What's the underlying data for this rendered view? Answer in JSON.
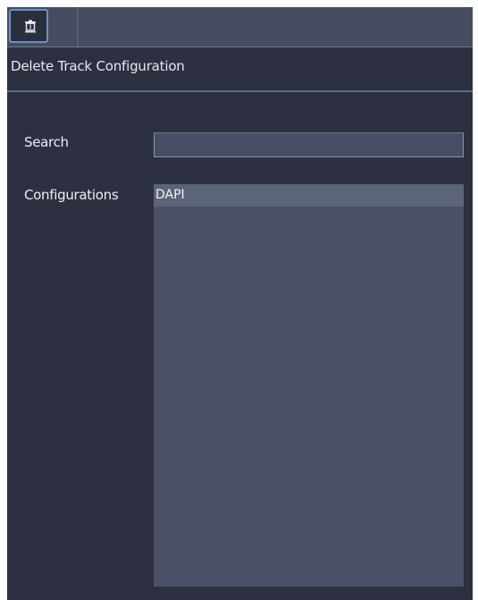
{
  "toolbar": {
    "icon": "delete-icon"
  },
  "dialog": {
    "title": "Delete Track Configuration"
  },
  "search": {
    "label": "Search",
    "value": "",
    "placeholder": ""
  },
  "configurations": {
    "label": "Configurations",
    "items": [
      {
        "label": "DAPI",
        "selected": true
      }
    ]
  },
  "colors": {
    "panel_bg": "#2c3040",
    "topbar_bg": "#464d61",
    "list_bg": "#4a5166",
    "selected_bg": "#5c6478",
    "focus_border": "#6b8fc4",
    "text": "#eceef4"
  }
}
